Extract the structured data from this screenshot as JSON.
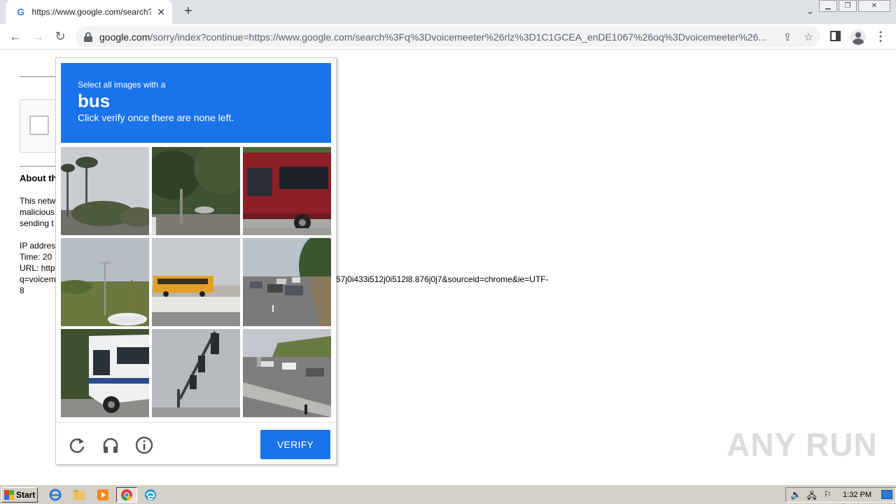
{
  "browser": {
    "tab_title": "https://www.google.com/search?q=",
    "url_host": "google.com",
    "url_path": "/sorry/index?continue=https://www.google.com/search%3Fq%3Dvoicemeeter%26rlz%3D1C1GCEA_enDE1067%26oq%3Dvoicemeeter%26..."
  },
  "page": {
    "about_heading": "About th",
    "lines": [
      "This netw",
      "malicious",
      "sending t"
    ],
    "ip_line": "IP addres",
    "time_line": "Time: 20",
    "url_line": "URL: http",
    "url_cont_left": "q=voicem",
    "url_cont_right": "57j0i433i512j0i512l8.876j0j7&sourceid=chrome&ie=UTF-",
    "url_last": "8"
  },
  "captcha": {
    "instruction_top": "Select all images with a",
    "target": "bus",
    "instruction_bottom": "Click verify once there are none left.",
    "verify_label": "VERIFY",
    "tiles": [
      "palm-trees-street",
      "trees-roadside",
      "red-bus",
      "street-light-field",
      "school-bus",
      "traffic-highway",
      "white-bus",
      "traffic-light",
      "highway-overpass"
    ]
  },
  "watermark": "ANY RUN",
  "taskbar": {
    "start_label": "Start",
    "clock": "1:32 PM"
  },
  "colors": {
    "accent": "#1a73e8",
    "taskbar": "#d4d0c8"
  }
}
